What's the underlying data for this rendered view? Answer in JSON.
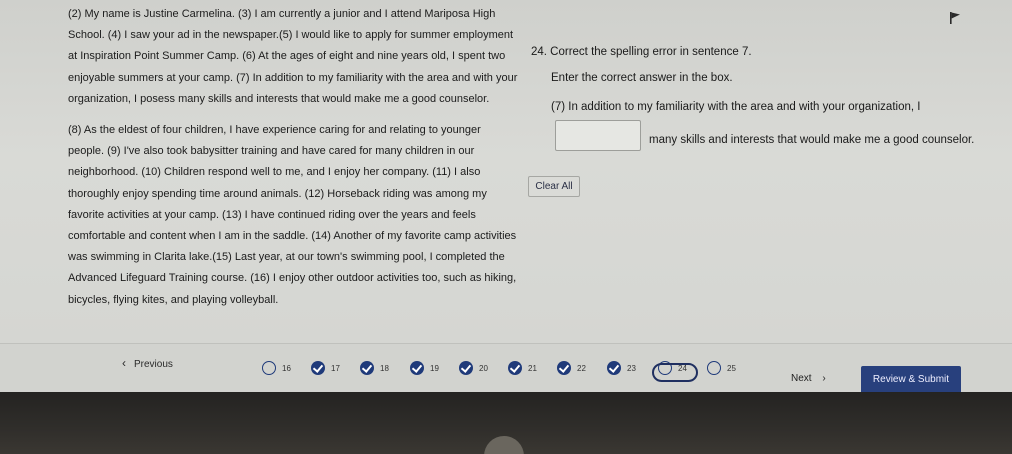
{
  "passage": {
    "paragraph1": "(2) My name is Justine Carmelina. (3) I am currently a junior and I attend Mariposa High School. (4) I saw your ad in the newspaper.(5) I would like to apply for summer employment at Inspiration Point Summer Camp. (6) At the ages of eight and nine years old, I spent two enjoyable summers at your camp. (7) In addition to my familiarity with the area and with your organization, I posess many skills and interests that would make me a good counselor.",
    "paragraph2": "(8) As the eldest of four children, I have experience caring for and relating to younger people. (9) I've also took babysitter training and have cared for many children in our neighborhood. (10) Children respond well to me, and I enjoy her company. (11) I also thoroughly enjoy spending time around animals. (12) Horseback riding was among my favorite activities at your camp. (13) I have continued riding over the years and feels comfortable and content when I am in the saddle. (14) Another of my favorite camp activities was swimming in Clarita lake.(15) Last year, at our town's swimming pool, I completed the Advanced Lifeguard Training course. (16) I enjoy other outdoor activities too, such as hiking, bicycles, flying kites, and playing volleyball."
  },
  "question": {
    "number_text": "24. Correct the spelling error in sentence 7.",
    "instruction": "Enter the correct answer in the box.",
    "sentence_start": "(7) In addition to my familiarity with the area and with your organization, I",
    "answer_value": "",
    "sentence_end": "many skills and interests that would make me a good counselor."
  },
  "buttons": {
    "clear_all": "Clear All",
    "previous": "Previous",
    "next": "Next",
    "review_submit": "Review & Submit"
  },
  "question_nav": [
    {
      "num": "16",
      "state": "unanswered"
    },
    {
      "num": "17",
      "state": "answered"
    },
    {
      "num": "18",
      "state": "answered"
    },
    {
      "num": "19",
      "state": "answered"
    },
    {
      "num": "20",
      "state": "answered"
    },
    {
      "num": "21",
      "state": "answered"
    },
    {
      "num": "22",
      "state": "answered"
    },
    {
      "num": "23",
      "state": "answered"
    },
    {
      "num": "24",
      "state": "current"
    },
    {
      "num": "25",
      "state": "unanswered"
    }
  ],
  "colors": {
    "accent": "#1f3a7a",
    "submit_bg": "#28407d"
  },
  "icons": {
    "flag": "flag-icon",
    "previous": "chevron-left-icon",
    "next": "chevron-right-icon",
    "answered": "check-circle-icon",
    "unanswered": "empty-circle-icon"
  }
}
